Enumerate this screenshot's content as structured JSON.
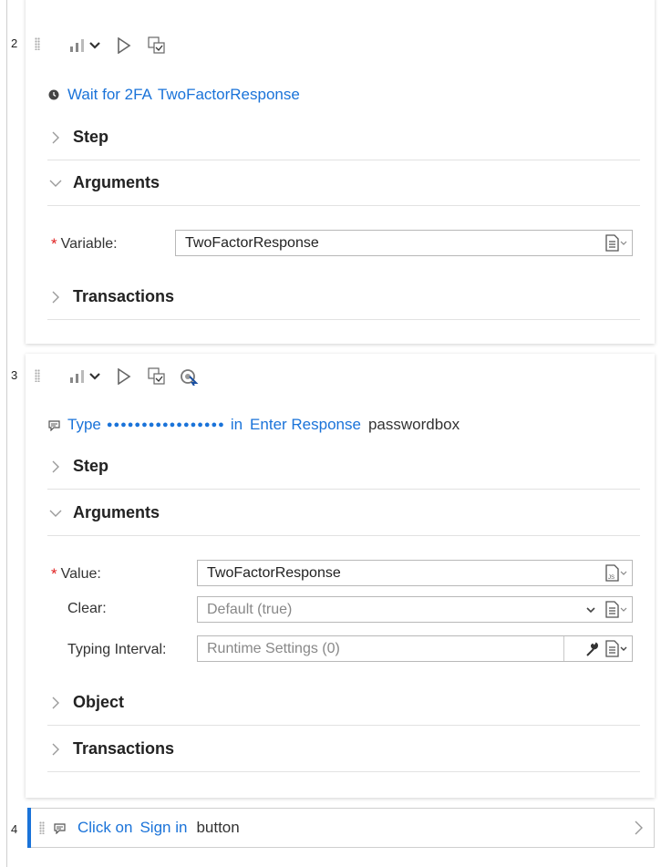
{
  "steps": [
    {
      "number": "2",
      "title": {
        "prefix": "Wait for 2FA",
        "link": "TwoFactorResponse"
      },
      "sections": {
        "step": "Step",
        "arguments": "Arguments",
        "transactions": "Transactions"
      },
      "fields": [
        {
          "label": "Variable:",
          "required": true,
          "value": "TwoFactorResponse"
        }
      ],
      "icons": [
        "clock-icon",
        "bar-chart-icon",
        "dropdown-chevron-icon",
        "play-icon",
        "screenshot-icon",
        "document-icon"
      ]
    },
    {
      "number": "3",
      "title": {
        "prefix": "Type",
        "masked": "●●●●●●●●●●●●●●●●●",
        "in": "in",
        "link": "Enter Response",
        "suffix": "passwordbox"
      },
      "sections": {
        "step": "Step",
        "arguments": "Arguments",
        "object": "Object",
        "transactions": "Transactions"
      },
      "fields": [
        {
          "label": "Value:",
          "required": true,
          "value": "TwoFactorResponse"
        },
        {
          "label": "Clear:",
          "required": false,
          "value": "Default (true)"
        },
        {
          "label": "Typing Interval:",
          "required": false,
          "value": "Runtime Settings (0)"
        }
      ],
      "icons": [
        "comment-icon",
        "bar-chart-icon",
        "dropdown-chevron-icon",
        "play-icon",
        "screenshot-icon",
        "object-spy-icon",
        "js-document-icon",
        "wrench-icon"
      ]
    },
    {
      "number": "4",
      "title": {
        "prefix": "Click on",
        "link": "Sign in",
        "suffix": "button"
      },
      "icons": [
        "comment-icon",
        "chevron-right-icon"
      ]
    }
  ],
  "colors": {
    "link": "#1a73d9",
    "required": "#e02020",
    "selected_accent": "#1a73d9"
  }
}
